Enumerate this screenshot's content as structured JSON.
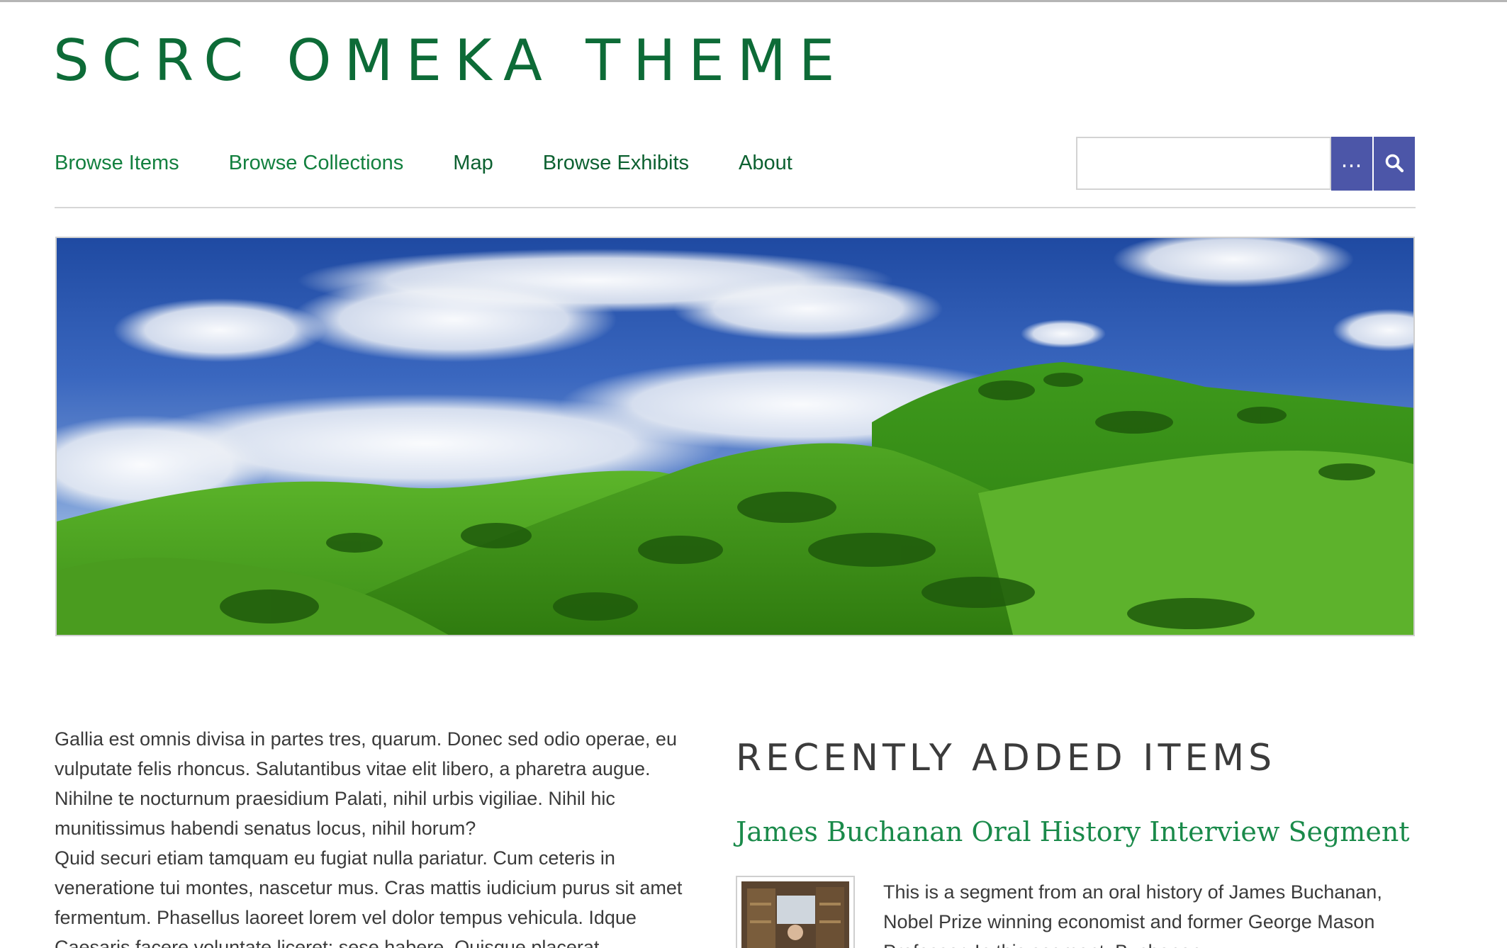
{
  "site": {
    "title": "SCRC OMEKA THEME"
  },
  "nav": {
    "items": [
      {
        "label": "Browse Items"
      },
      {
        "label": "Browse Collections"
      },
      {
        "label": "Map"
      },
      {
        "label": "Browse Exhibits"
      },
      {
        "label": "About"
      }
    ]
  },
  "search": {
    "value": "",
    "advanced_label": "…"
  },
  "hero": {
    "subject": "green hills under blue sky with clouds"
  },
  "intro": {
    "paragraph_1": "Gallia est omnis divisa in partes tres, quarum. Donec sed odio operae, eu vulputate felis rhoncus. Salutantibus vitae elit libero, a pharetra augue. Nihilne te nocturnum praesidium Palati, nihil urbis vigiliae. Nihil hic munitissimus habendi senatus locus, nihil horum?",
    "paragraph_2": "Quid securi etiam tamquam eu fugiat nulla pariatur. Cum ceteris in veneratione tui montes, nascetur mus. Cras mattis iudicium purus sit amet fermentum. Phasellus laoreet lorem vel dolor tempus vehicula. Idque Caesaris facere voluntate liceret: sese habere. Quisque placerat"
  },
  "recent": {
    "heading": "RECENTLY ADDED ITEMS",
    "items": [
      {
        "title": "James Buchanan Oral History Interview Segment",
        "description": "This is a segment from an oral history of James Buchanan, Nobel Prize winning economist and former George Mason Professor. In this segment, Buchanan"
      }
    ]
  },
  "colors": {
    "title_green": "#0d6b37",
    "link_green": "#13803f",
    "button_blue": "#4c56a8",
    "item_title_green": "#1a8a4a"
  },
  "icons": {
    "advanced_search": "ellipsis-icon",
    "search": "magnifier-icon"
  }
}
